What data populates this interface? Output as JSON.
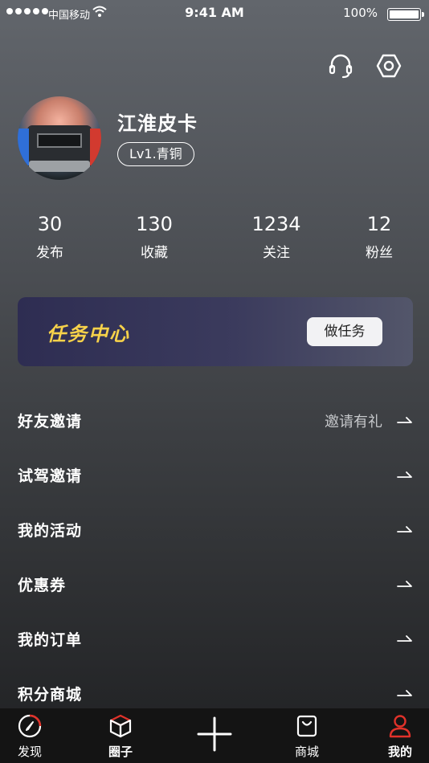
{
  "status_bar": {
    "carrier": "中国移动",
    "time": "9:41 AM",
    "battery": "100%"
  },
  "header": {
    "icons": [
      "headset-icon",
      "settings-icon"
    ]
  },
  "profile": {
    "username": "江淮皮卡",
    "level": "Lv1.青铜"
  },
  "stats": [
    {
      "value": "30",
      "label": "发布"
    },
    {
      "value": "130",
      "label": "收藏"
    },
    {
      "value": "1234",
      "label": "关注"
    },
    {
      "value": "12",
      "label": "粉丝"
    }
  ],
  "task_center": {
    "title": "任务中心",
    "button": "做任务",
    "title_color": "#f7d24a"
  },
  "menu": [
    {
      "label": "好友邀请",
      "extra": "邀请有礼"
    },
    {
      "label": "试驾邀请",
      "extra": ""
    },
    {
      "label": "我的活动",
      "extra": ""
    },
    {
      "label": "优惠券",
      "extra": ""
    },
    {
      "label": "我的订单",
      "extra": ""
    },
    {
      "label": "积分商城",
      "extra": ""
    }
  ],
  "tab_bar": {
    "items": [
      {
        "label": "发现",
        "icon": "compass-icon"
      },
      {
        "label": "圈子",
        "icon": "cube-icon"
      },
      {
        "label": "",
        "icon": "plus-icon"
      },
      {
        "label": "商城",
        "icon": "shopping-bag-icon"
      },
      {
        "label": "我的",
        "icon": "user-icon"
      }
    ],
    "accent": "#e0322a"
  }
}
